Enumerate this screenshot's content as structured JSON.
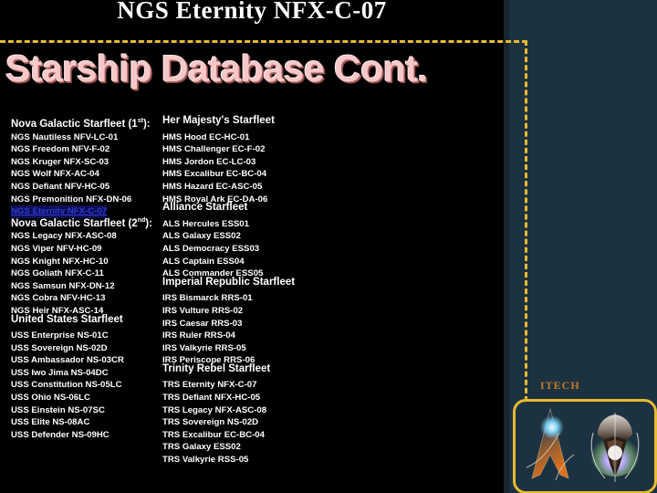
{
  "slide": {
    "banner_title": "NGS Eternity NFX-C-07",
    "heading": "Starship Database Cont.",
    "badge_label": "ITECH"
  },
  "colors": {
    "background": "#1d3240",
    "panel": "#000000",
    "dash_border": "#e8b931",
    "heading_text": "#f6c8c8",
    "body_text": "#ffffff",
    "highlight_text": "#2f3cd0",
    "highlight_bg": "#0d0d55",
    "badge_text": "#c87a28"
  },
  "columns": {
    "left": [
      {
        "type": "heading",
        "label": "Nova Galactic Starfleet (1st):",
        "sup": "st",
        "base": "Nova Galactic Starfleet (1"
      },
      {
        "type": "ship",
        "label": "NGS Nautiless NFV-LC-01"
      },
      {
        "type": "ship",
        "label": "NGS Freedom NFV-F-02"
      },
      {
        "type": "ship",
        "label": "NGS Kruger NFX-SC-03"
      },
      {
        "type": "ship",
        "label": "NGS Wolf NFX-AC-04"
      },
      {
        "type": "ship",
        "label": "NGS Defiant NFV-HC-05"
      },
      {
        "type": "ship",
        "label": "NGS Premonition NFX-DN-06"
      },
      {
        "type": "ship",
        "label": "NGS Eternity NFX-C-07",
        "highlight": true
      },
      {
        "type": "heading",
        "label": "Nova Galactic Starfleet (2nd):",
        "sup": "nd",
        "base": "Nova Galactic Starfleet (2"
      },
      {
        "type": "ship",
        "label": "NGS Legacy NFX-ASC-08"
      },
      {
        "type": "ship",
        "label": "NGS Viper NFV-HC-09"
      },
      {
        "type": "ship",
        "label": "NGS Knight NFX-HC-10"
      },
      {
        "type": "ship",
        "label": "NGS Goliath NFX-C-11"
      },
      {
        "type": "ship",
        "label": "NGS Samsun NFX-DN-12"
      },
      {
        "type": "ship",
        "label": "NGS Cobra NFV-HC-13"
      },
      {
        "type": "ship",
        "label": "NGS Heir NFX-ASC-14"
      },
      {
        "type": "heading",
        "label": "United States Starfleet"
      },
      {
        "type": "ship",
        "label": "USS Enterprise NS-01C"
      },
      {
        "type": "ship",
        "label": "USS Sovereign NS-02D"
      },
      {
        "type": "ship",
        "label": "USS Ambassador NS-03CR"
      },
      {
        "type": "ship",
        "label": "USS Iwo Jima NS-04DC"
      },
      {
        "type": "ship",
        "label": "USS Constitution NS-05LC"
      },
      {
        "type": "ship",
        "label": "USS Ohio NS-06LC"
      },
      {
        "type": "ship",
        "label": "USS Einstein NS-07SC"
      },
      {
        "type": "ship",
        "label": "USS Elite NS-08AC"
      },
      {
        "type": "ship",
        "label": "USS Defender NS-09HC"
      }
    ],
    "right": [
      {
        "type": "heading",
        "label": "Her Majesty's Starfleet"
      },
      {
        "type": "ship",
        "label": "HMS Hood EC-HC-01"
      },
      {
        "type": "ship",
        "label": "HMS Challenger EC-F-02"
      },
      {
        "type": "ship",
        "label": "HMS Jordon EC-LC-03"
      },
      {
        "type": "ship",
        "label": "HMS Excalibur EC-BC-04"
      },
      {
        "type": "ship",
        "label": "HMS Hazard EC-ASC-05"
      },
      {
        "type": "ship",
        "label": "HMS Royal Ark EC-DA-06"
      },
      {
        "type": "heading",
        "label": "Alliance Starfleet"
      },
      {
        "type": "ship",
        "label": "ALS Hercules ESS01"
      },
      {
        "type": "ship",
        "label": "ALS Galaxy ESS02"
      },
      {
        "type": "ship",
        "label": "ALS Democracy ESS03"
      },
      {
        "type": "ship",
        "label": "ALS Captain ESS04"
      },
      {
        "type": "ship",
        "label": "ALS Commander ESS05"
      },
      {
        "type": "heading",
        "label": "Imperial Republic Starfleet"
      },
      {
        "type": "ship",
        "label": "IRS Bismarck RRS-01"
      },
      {
        "type": "ship",
        "label": "IRS Vulture RRS-02"
      },
      {
        "type": "ship",
        "label": "IRS Caesar RRS-03"
      },
      {
        "type": "ship",
        "label": "IRS Ruler RRS-04"
      },
      {
        "type": "ship",
        "label": "IRS Valkyrie RRS-05"
      },
      {
        "type": "ship",
        "label": "IRS Periscope RRS-06"
      },
      {
        "type": "heading",
        "label": "Trinity Rebel Starfleet"
      },
      {
        "type": "ship",
        "label": "TRS Eternity NFX-C-07"
      },
      {
        "type": "ship",
        "label": "TRS Defiant NFX-HC-05"
      },
      {
        "type": "ship",
        "label": "TRS Legacy NFX-ASC-08"
      },
      {
        "type": "ship",
        "label": "TRS Sovereign NS-02D"
      },
      {
        "type": "ship",
        "label": "TRS Excalibur EC-BC-04"
      },
      {
        "type": "ship",
        "label": "TRS Galaxy ESS02"
      },
      {
        "type": "ship",
        "label": "TRS Valkyrie RSS-05"
      }
    ]
  }
}
